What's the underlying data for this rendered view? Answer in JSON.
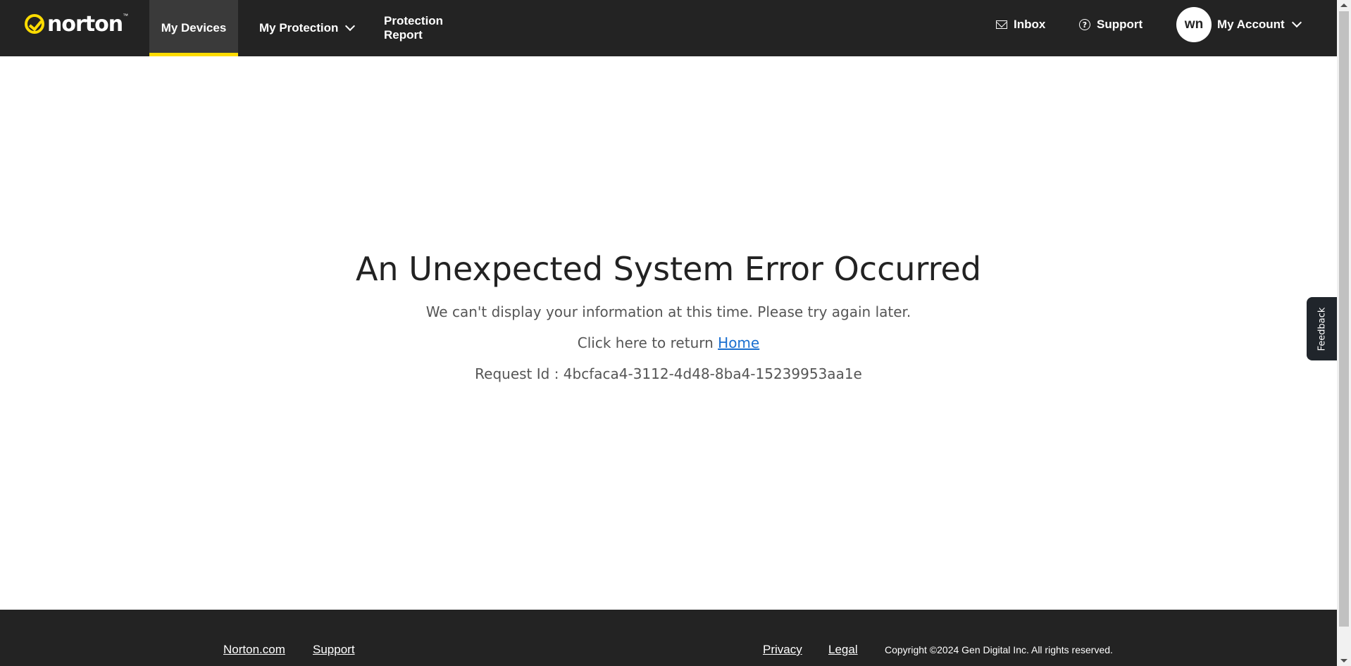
{
  "header": {
    "logo_text": "norton",
    "logo_tm": "™",
    "nav": {
      "my_devices": "My Devices",
      "my_protection": "My Protection",
      "protection_report": "Protection Report"
    },
    "inbox": "Inbox",
    "support": "Support",
    "avatar_initials": "wn",
    "account": "My Account"
  },
  "main": {
    "title": "An Unexpected System Error Occurred",
    "message": "We can't display your information at this time. Please try again later.",
    "return_prefix": "Click here to return ",
    "home_link": "Home",
    "request_id": "Request Id : 4bcfaca4-3112-4d48-8ba4-15239953aa1e"
  },
  "feedback_tab": "Feedback",
  "footer": {
    "norton_com": "Norton.com",
    "support": "Support",
    "privacy": "Privacy",
    "legal": "Legal",
    "copyright": "Copyright ©2024 Gen Digital Inc. All rights reserved."
  },
  "colors": {
    "header_bg": "#232323",
    "accent_yellow": "#fedc00",
    "link_blue": "#1a6fd0"
  },
  "icons": [
    "norton-check-icon",
    "chevron-down-icon",
    "mail-icon",
    "help-icon"
  ]
}
